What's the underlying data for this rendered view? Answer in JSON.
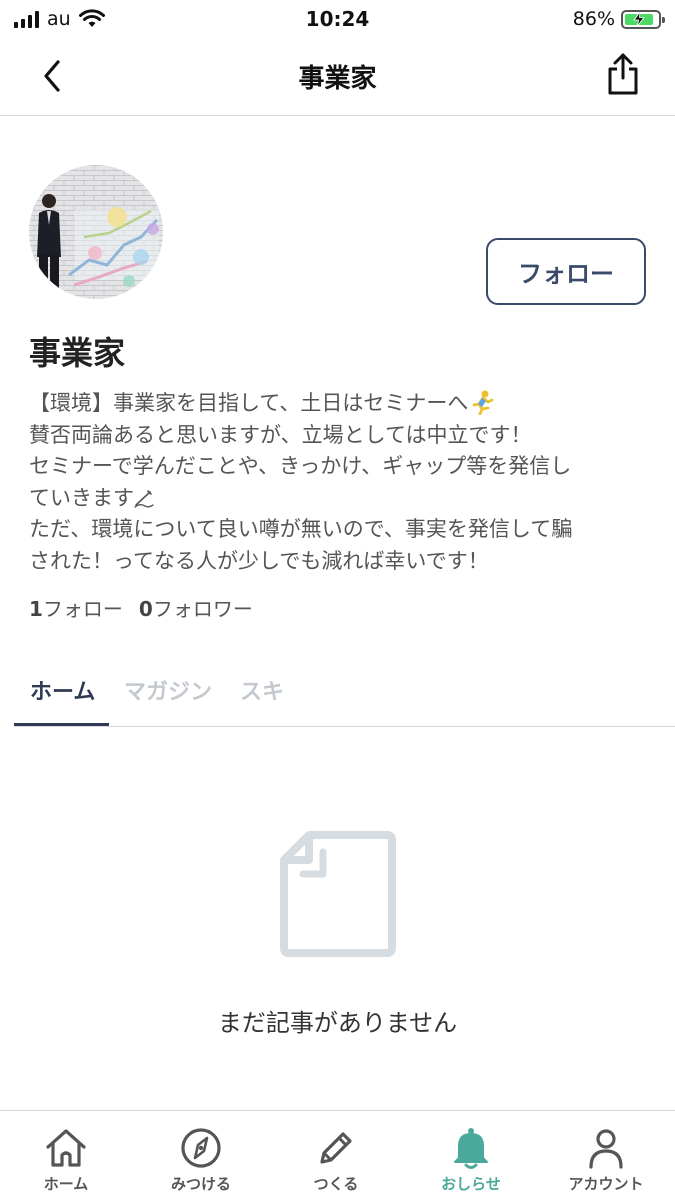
{
  "status_bar": {
    "carrier": "au",
    "time": "10:24",
    "battery_percent": "86%",
    "battery_level": 0.86,
    "battery_color": "#4cd964"
  },
  "nav": {
    "title": "事業家",
    "back_icon": "chevron-left-icon",
    "share_icon": "share-icon"
  },
  "profile": {
    "name": "事業家",
    "follow_label": "フォロー",
    "bio_lines": [
      "【環境】事業家を目指して、土日はセミナーへ",
      "賛否両論あると思いますが、立場としては中立です！",
      "セミナーで学んだことや、きっかけ、ギャップ等を発信し",
      "ていきます",
      "ただ、環境について良い噂が無いので、事実を発信して騙",
      "された！ってなる人が少しでも減れば幸いです！"
    ],
    "follow_count": "1",
    "follow_label_text": "フォロー",
    "follower_count": "0",
    "follower_label_text": "フォロワー"
  },
  "tabs": [
    {
      "label": "ホーム",
      "active": true
    },
    {
      "label": "マガジン",
      "active": false
    },
    {
      "label": "スキ",
      "active": false
    }
  ],
  "empty_state": {
    "icon": "document-icon",
    "message": "まだ記事がありません"
  },
  "tabbar": {
    "items": [
      {
        "label": "ホーム",
        "icon": "home-icon"
      },
      {
        "label": "みつける",
        "icon": "compass-icon"
      },
      {
        "label": "つくる",
        "icon": "pencil-icon"
      },
      {
        "label": "おしらせ",
        "icon": "bell-icon",
        "active": true
      },
      {
        "label": "アカウント",
        "icon": "person-icon"
      }
    ]
  },
  "colors": {
    "accent_navy": "#2f3b56",
    "active_green": "#4aa99a",
    "inactive_tab": "#c3c9cf",
    "empty_icon": "#d5dde3"
  }
}
